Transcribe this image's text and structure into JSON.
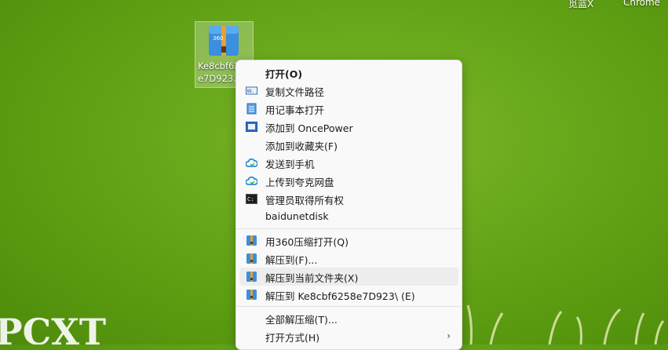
{
  "desktop": {
    "top_labels": [
      "觅蓝X",
      "Chrome"
    ],
    "file_icon": {
      "name_line1": "Ke8cbf6258",
      "name_line2": "e7D923...",
      "badge": "360 ZIP"
    },
    "wallpaper_text": "PCXT"
  },
  "context_menu": {
    "items": [
      {
        "label": "打开(O)",
        "icon": "none"
      },
      {
        "label": "复制文件路径",
        "icon": "copy-path-icon"
      },
      {
        "label": "用记事本打开",
        "icon": "notepad-icon"
      },
      {
        "label": "添加到 OncePower",
        "icon": "oncepower-icon"
      },
      {
        "label": "添加到收藏夹(F)",
        "icon": "none"
      },
      {
        "label": "发送到手机",
        "icon": "cloud-icon"
      },
      {
        "label": "上传到夸克网盘",
        "icon": "cloud-icon"
      },
      {
        "label": "管理员取得所有权",
        "icon": "cmd-icon"
      },
      {
        "label": "baidunetdisk",
        "icon": "none"
      },
      {
        "label": "用360压缩打开(Q)",
        "icon": "360zip-icon"
      },
      {
        "label": "解压到(F)...",
        "icon": "360zip-icon"
      },
      {
        "label": "解压到当前文件夹(X)",
        "icon": "360zip-icon"
      },
      {
        "label": "解压到 Ke8cbf6258e7D923\\ (E)",
        "icon": "360zip-icon"
      },
      {
        "label": "全部解压缩(T)...",
        "icon": "none"
      },
      {
        "label": "打开方式(H)",
        "icon": "none",
        "submenu_arrow": "›"
      }
    ]
  }
}
